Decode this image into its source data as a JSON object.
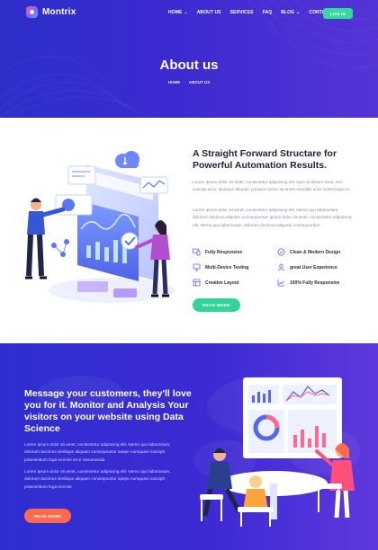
{
  "brand": {
    "name": "Montrix"
  },
  "nav": {
    "items": [
      {
        "label": "HOME",
        "has_dropdown": true
      },
      {
        "label": "ABOUT US",
        "has_dropdown": false
      },
      {
        "label": "SERVICES",
        "has_dropdown": false
      },
      {
        "label": "FAQ",
        "has_dropdown": false
      },
      {
        "label": "BLOG",
        "has_dropdown": true
      },
      {
        "label": "CONTACT",
        "has_dropdown": false
      }
    ],
    "login_label": "LOG IN"
  },
  "hero": {
    "title": "About us",
    "breadcrumb": [
      "HOME",
      "ABOUT US"
    ]
  },
  "about": {
    "title": "A Straight Forward Structare for Powerful Automation Results.",
    "paragraph_1": "Lorem ipsum dolor sit amet, consectetur adipiscing elit. Duis at dictum risus, non suscipit arcu. Quisque aliquam posuere tortor, sit amet convallis nunc scelerisque in.",
    "paragraph_2": "Lorem ipsum dolor sit amet, consectetur adipiscing elit. Nemo quo laboriosam, dolorum ducimus aliquam consequuntur! ipsum dolor sit amet, consectetur adipiscing elit. Nemo quo laboriosam, dolorum ducimus aliquam consequuntur!",
    "features": [
      {
        "label": "Fully Responsive",
        "icon": "responsive-icon"
      },
      {
        "label": "Clean & Modern Design",
        "icon": "design-icon"
      },
      {
        "label": "Multi-Device Testing",
        "icon": "devices-icon"
      },
      {
        "label": "great User Experience",
        "icon": "user-experience-icon"
      },
      {
        "label": "Creative Layout",
        "icon": "layout-icon"
      },
      {
        "label": "100% Fully Responsive",
        "icon": "chart-icon"
      }
    ],
    "button_label": "READ MORE"
  },
  "data_science": {
    "title": "Message your customers, they'll love you for it. Monitor and Analysis Your visitors on your website using Data Science",
    "paragraph_1": "Lorem ipsum dolor sit amet, consectetur adipiscing elit. Nemo quo laboriosam, dolorum ducimus similique aliquam consequuntur saepe numquam suscipit praesentium fuga eveniet error assumenda",
    "paragraph_2": "Lorem ipsum dolor sit amet, consectetur adipiscing elit. Nemo quo laboriosam, dolorum ducimus similique aliquam consequuntur saepe numquam suscipit praesentium fuga eveniet",
    "button_label": "READ MORE"
  },
  "colors": {
    "primary_blue": "#3b2ad0",
    "accent_green": "#35d99a",
    "accent_orange": "#ff6a4d",
    "heading": "#1f1f3f",
    "body_text": "#8a8aa3"
  }
}
